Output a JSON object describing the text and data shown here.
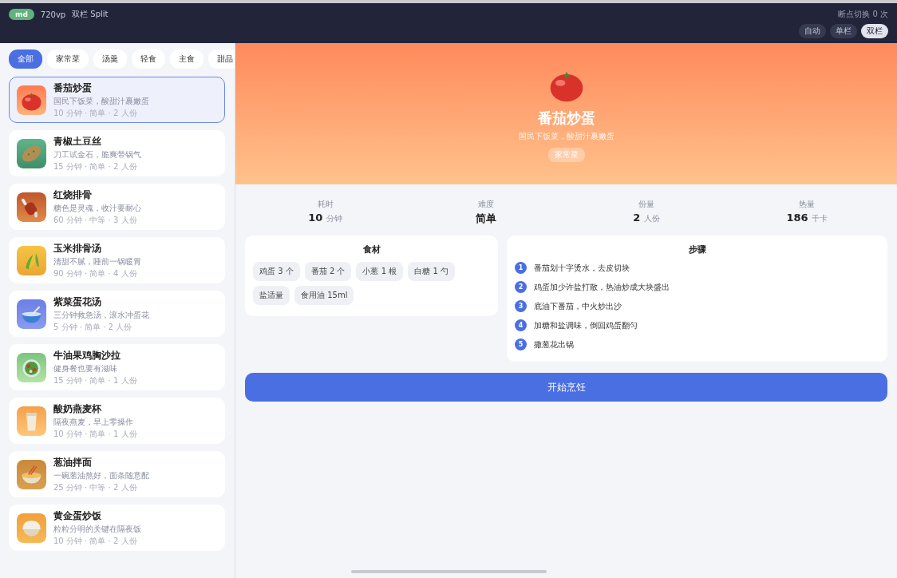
{
  "top_bar": {
    "badge": "md",
    "viewport": "720vp",
    "layout": "双栏 Split",
    "counter": "断点切换 0 次",
    "modes": [
      {
        "label": "自动",
        "selected": false
      },
      {
        "label": "单栏",
        "selected": false
      },
      {
        "label": "双栏",
        "selected": true
      }
    ]
  },
  "categories": [
    {
      "label": "全部",
      "selected": true
    },
    {
      "label": "家常菜",
      "selected": false
    },
    {
      "label": "汤羹",
      "selected": false
    },
    {
      "label": "轻食",
      "selected": false
    },
    {
      "label": "主食",
      "selected": false
    },
    {
      "label": "甜品",
      "selected": false
    }
  ],
  "recipes": [
    {
      "kind": "tomato",
      "name": "番茄炒蛋",
      "desc": "国民下饭菜，酸甜汁裹嫩蛋",
      "meta": "10 分钟 · 简单 · 2 人份",
      "selected": true
    },
    {
      "kind": "potato",
      "name": "青椒土豆丝",
      "desc": "刀工试金石，脆爽带锅气",
      "meta": "15 分钟 · 简单 · 2 人份",
      "selected": false
    },
    {
      "kind": "ribs",
      "name": "红烧排骨",
      "desc": "糖色是灵魂，收汁要耐心",
      "meta": "60 分钟 · 中等 · 3 人份",
      "selected": false
    },
    {
      "kind": "corn",
      "name": "玉米排骨汤",
      "desc": "清甜不腻，睡前一锅暖胃",
      "meta": "90 分钟 · 简单 · 4 人份",
      "selected": false
    },
    {
      "kind": "bowl",
      "name": "紫菜蛋花汤",
      "desc": "三分钟救急汤，滚水冲蛋花",
      "meta": "5 分钟 · 简单 · 2 人份",
      "selected": false
    },
    {
      "kind": "salad",
      "name": "牛油果鸡胸沙拉",
      "desc": "健身餐也要有滋味",
      "meta": "15 分钟 · 简单 · 1 人份",
      "selected": false
    },
    {
      "kind": "milk",
      "name": "酸奶燕麦杯",
      "desc": "隔夜燕麦，早上零操作",
      "meta": "10 分钟 · 简单 · 1 人份",
      "selected": false
    },
    {
      "kind": "noodles",
      "name": "葱油拌面",
      "desc": "一碗葱油熬好，面条随意配",
      "meta": "25 分钟 · 中等 · 2 人份",
      "selected": false
    },
    {
      "kind": "rice",
      "name": "黄金蛋炒饭",
      "desc": "粒粒分明的关键在隔夜饭",
      "meta": "10 分钟 · 简单 · 2 人份",
      "selected": false
    }
  ],
  "detail": {
    "kind": "tomato",
    "name": "番茄炒蛋",
    "desc": "国民下饭菜，酸甜汁裹嫩蛋",
    "tag": "家常菜",
    "stats": [
      {
        "label": "耗时",
        "value": "10",
        "unit": "分钟"
      },
      {
        "label": "难度",
        "value": "简单"
      },
      {
        "label": "份量",
        "value": "2",
        "unit": "人份"
      },
      {
        "label": "热量",
        "value": "186",
        "unit": "千卡"
      }
    ],
    "ingredients_title": "食材",
    "ingredients": [
      "鸡蛋 3 个",
      "番茄 2 个",
      "小葱 1 根",
      "白糖 1 勺",
      "盐适量",
      "食用油 15ml"
    ],
    "steps_title": "步骤",
    "steps": [
      {
        "number": "1",
        "text": "番茄划十字烫水，去皮切块"
      },
      {
        "number": "2",
        "text": "鸡蛋加少许盐打散，热油炒成大块盛出"
      },
      {
        "number": "3",
        "text": "底油下番茄，中火炒出沙"
      },
      {
        "number": "4",
        "text": "加糖和盐调味，倒回鸡蛋翻匀"
      },
      {
        "number": "5",
        "text": "撒葱花出锅"
      }
    ],
    "start_button": "开始烹饪"
  }
}
